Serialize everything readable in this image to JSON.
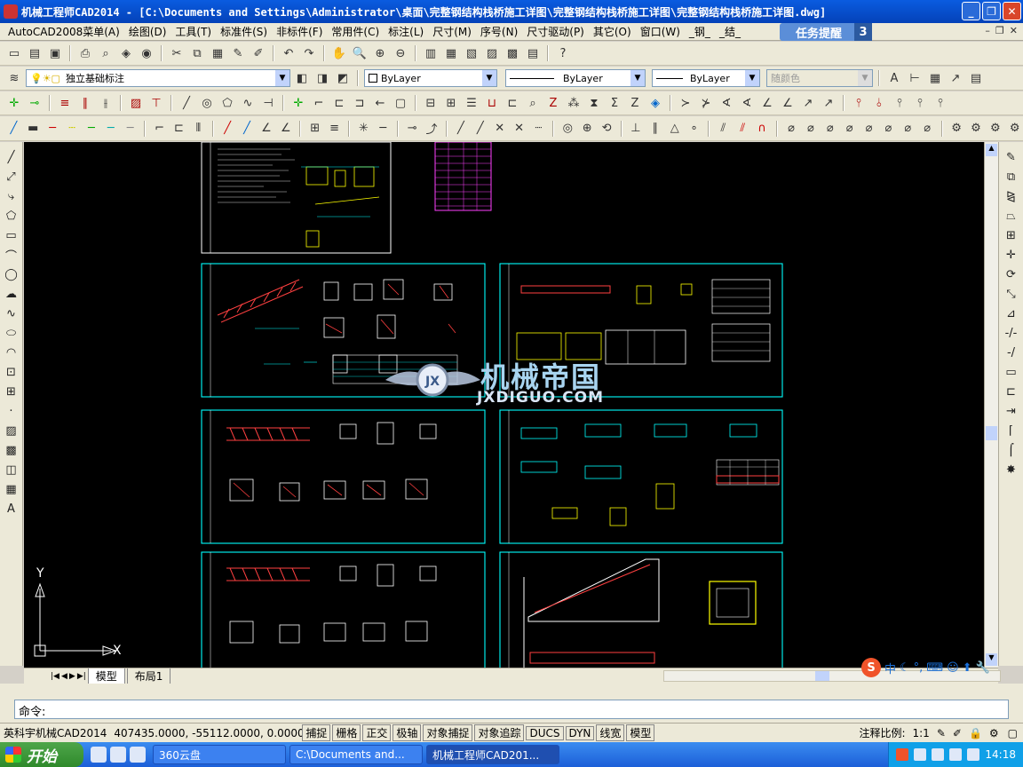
{
  "window": {
    "title": "机械工程师CAD2014 - [C:\\Documents and Settings\\Administrator\\桌面\\完整钢结构栈桥施工详图\\完整钢结构栈桥施工详图\\完整钢结构栈桥施工详图.dwg]"
  },
  "menu": {
    "items": [
      "AutoCAD2008菜单(A)",
      "绘图(D)",
      "工具(T)",
      "标准件(S)",
      "非标件(F)",
      "常用件(C)",
      "标注(L)",
      "尺寸(M)",
      "序号(N)",
      "尺寸驱动(P)",
      "其它(O)",
      "窗口(W)",
      "_钢_",
      "_结_"
    ],
    "task_reminder": "任务提醒",
    "task_count": "3"
  },
  "layers": {
    "current_layer": "独立基础标注",
    "color": "ByLayer",
    "linetype": "ByLayer",
    "lineweight": "ByLayer",
    "plotstyle": "随颜色"
  },
  "canvas": {
    "watermark_cn": "机械帝国",
    "watermark_en": "JXDIGUO.COM",
    "ucs_x": "X",
    "ucs_y": "Y"
  },
  "tabs": [
    "模型",
    "布局1"
  ],
  "command": {
    "prompt": "命令:"
  },
  "status": {
    "product": "英科宇机械CAD2014",
    "coords": "407435.0000, -55112.0000, 0.0000",
    "toggles": [
      "捕捉",
      "栅格",
      "正交",
      "极轴",
      "对象捕捉",
      "对象追踪",
      "DUCS",
      "DYN",
      "线宽",
      "模型"
    ],
    "annotation_scale_label": "注释比例:",
    "annotation_scale": "1:1"
  },
  "taskbar": {
    "start": "开始",
    "tasks": [
      "360云盘",
      "C:\\Documents and...",
      "机械工程师CAD201..."
    ],
    "time": "14:18"
  },
  "ime": {
    "lang": "中"
  }
}
